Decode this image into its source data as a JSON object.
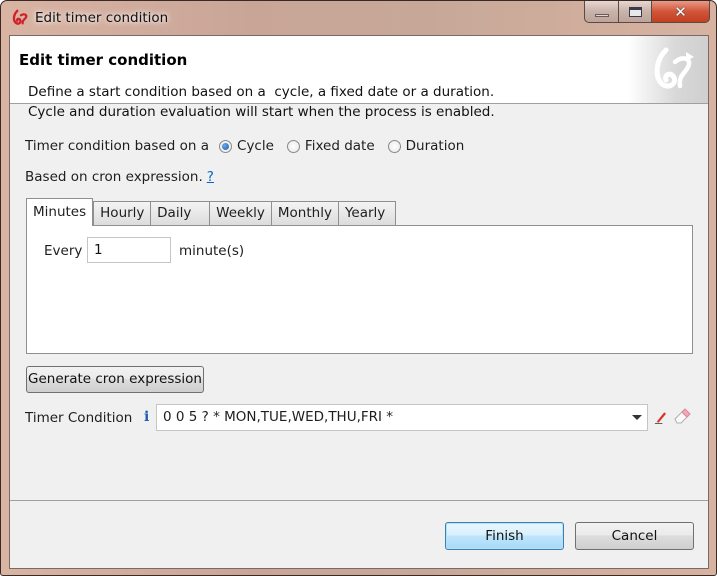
{
  "window": {
    "title": "Edit timer condition",
    "app_icon": "bonita-logo-icon",
    "caption_buttons": [
      "minimize",
      "maximize",
      "close"
    ]
  },
  "header": {
    "title": "Edit timer condition",
    "description_line1": "Define a start condition based on a  cycle, a fixed date or a duration.",
    "description_line2": "Cycle and duration evaluation will start when the process is enabled."
  },
  "condition_type": {
    "label": "Timer condition based on a",
    "options": [
      {
        "label": "Cycle",
        "checked": true
      },
      {
        "label": "Fixed date",
        "checked": false
      },
      {
        "label": "Duration",
        "checked": false
      }
    ]
  },
  "cron": {
    "label": "Based on cron expression.",
    "help_link": "?"
  },
  "tabs": [
    {
      "label": "Minutes",
      "active": true
    },
    {
      "label": "Hourly",
      "active": false
    },
    {
      "label": "Daily",
      "active": false
    },
    {
      "label": "Weekly",
      "active": false
    },
    {
      "label": "Monthly",
      "active": false
    },
    {
      "label": "Yearly",
      "active": false
    }
  ],
  "minutes_panel": {
    "every_label": "Every",
    "every_value": "1",
    "unit_label": "minute(s)"
  },
  "generate_button": "Generate cron expression",
  "timer_condition": {
    "label": "Timer Condition",
    "info_icon": "i",
    "value": "0 0 5 ? * MON,TUE,WED,THU,FRI *"
  },
  "footer": {
    "finish_label": "Finish",
    "cancel_label": "Cancel"
  }
}
